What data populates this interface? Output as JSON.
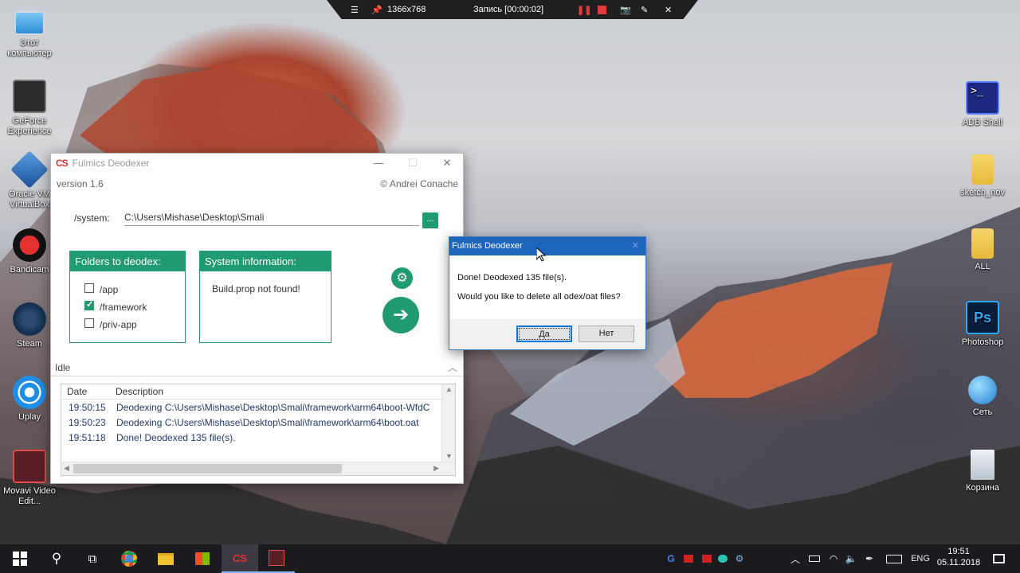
{
  "recorder": {
    "resolution": "1366x768",
    "status": "Запись [00:00:02]"
  },
  "desktop_left": [
    {
      "label": "Этот компьютер"
    },
    {
      "label": "GeForce Experience"
    },
    {
      "label": "Oracle VM VirtualBox"
    },
    {
      "label": "Bandicam"
    },
    {
      "label": "Steam"
    },
    {
      "label": "Uplay"
    },
    {
      "label": "Movavi Video Edit..."
    }
  ],
  "desktop_right": [
    {
      "label": "ADB Shell"
    },
    {
      "label": "sketch_nov"
    },
    {
      "label": "ALL"
    },
    {
      "label": "Photoshop"
    },
    {
      "label": "Сеть"
    },
    {
      "label": "Корзина"
    }
  ],
  "app": {
    "logo": "CS",
    "title": "Fulmics Deodexer",
    "version": "version 1.6",
    "copyright": "© Andrei Conache",
    "system_label": "/system:",
    "system_path": "C:\\Users\\Mishase\\Desktop\\Smali",
    "browse_label": "...",
    "folders_header": "Folders to deodex:",
    "folders": [
      {
        "label": "/app",
        "checked": false
      },
      {
        "label": "/framework",
        "checked": true
      },
      {
        "label": "/priv-app",
        "checked": false
      }
    ],
    "sysinfo_header": "System information:",
    "sysinfo_text": "Build.prop not found!",
    "status": "Idle",
    "log_headers": {
      "date": "Date",
      "description": "Description"
    },
    "log": [
      {
        "date": "19:50:15",
        "text": "Deodexing C:\\Users\\Mishase\\Desktop\\Smali\\framework\\arm64\\boot-WfdC"
      },
      {
        "date": "19:50:23",
        "text": "Deodexing C:\\Users\\Mishase\\Desktop\\Smali\\framework\\arm64\\boot.oat"
      },
      {
        "date": "19:51:18",
        "text": "Done! Deodexed 135 file(s)."
      }
    ]
  },
  "dialog": {
    "title": "Fulmics Deodexer",
    "message1": "Done! Deodexed 135 file(s).",
    "message2": "Would you like to delete all odex/oat files?",
    "yes": "Да",
    "no": "Нет"
  },
  "taskbar": {
    "lang": "ENG",
    "time": "19:51",
    "date": "05.11.2018"
  },
  "colors": {
    "accent": "#1f9a73",
    "dialog_title": "#1d65bd",
    "taskbar": "#1b1a1f"
  }
}
